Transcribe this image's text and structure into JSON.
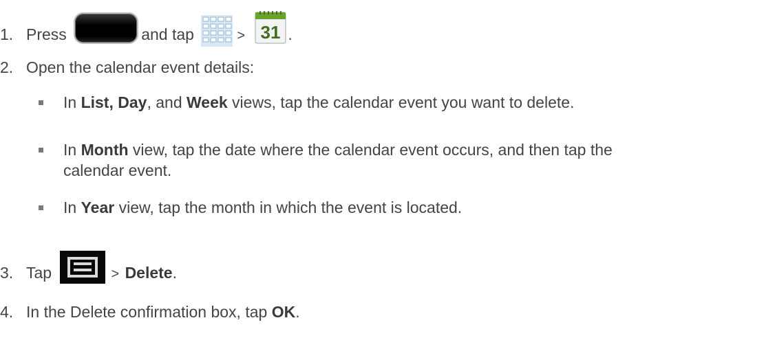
{
  "steps": [
    {
      "num": "1.",
      "text_a": "Press",
      "text_b": "and tap",
      "sep": ">",
      "end": "."
    },
    {
      "num": "2.",
      "text": "Open the calendar event details:"
    },
    {
      "num": "3.",
      "text_a": "Tap",
      "sep": ">",
      "bold": "Delete",
      "end": "."
    },
    {
      "num": "4.",
      "text_a": "In the Delete confirmation box, tap",
      "bold": "OK",
      "end": "."
    }
  ],
  "bullets": [
    {
      "pre": "In ",
      "b1": "List, Day",
      "mid1": ", and ",
      "b2": "Week",
      "post": " views, tap the calendar event you want to delete."
    },
    {
      "pre": "In ",
      "b1": "Month",
      "post": " view, tap the date where the calendar event occurs, and then tap the",
      "line2": "calendar event."
    },
    {
      "pre": "In ",
      "b1": "Year",
      "post": " view, tap the month in which the event is located."
    }
  ],
  "icons": {
    "home": "home-key-icon",
    "apps": "apps-grid-icon",
    "calendar": "calendar-icon",
    "calendar_day": "31",
    "menu": "menu-key-icon"
  }
}
